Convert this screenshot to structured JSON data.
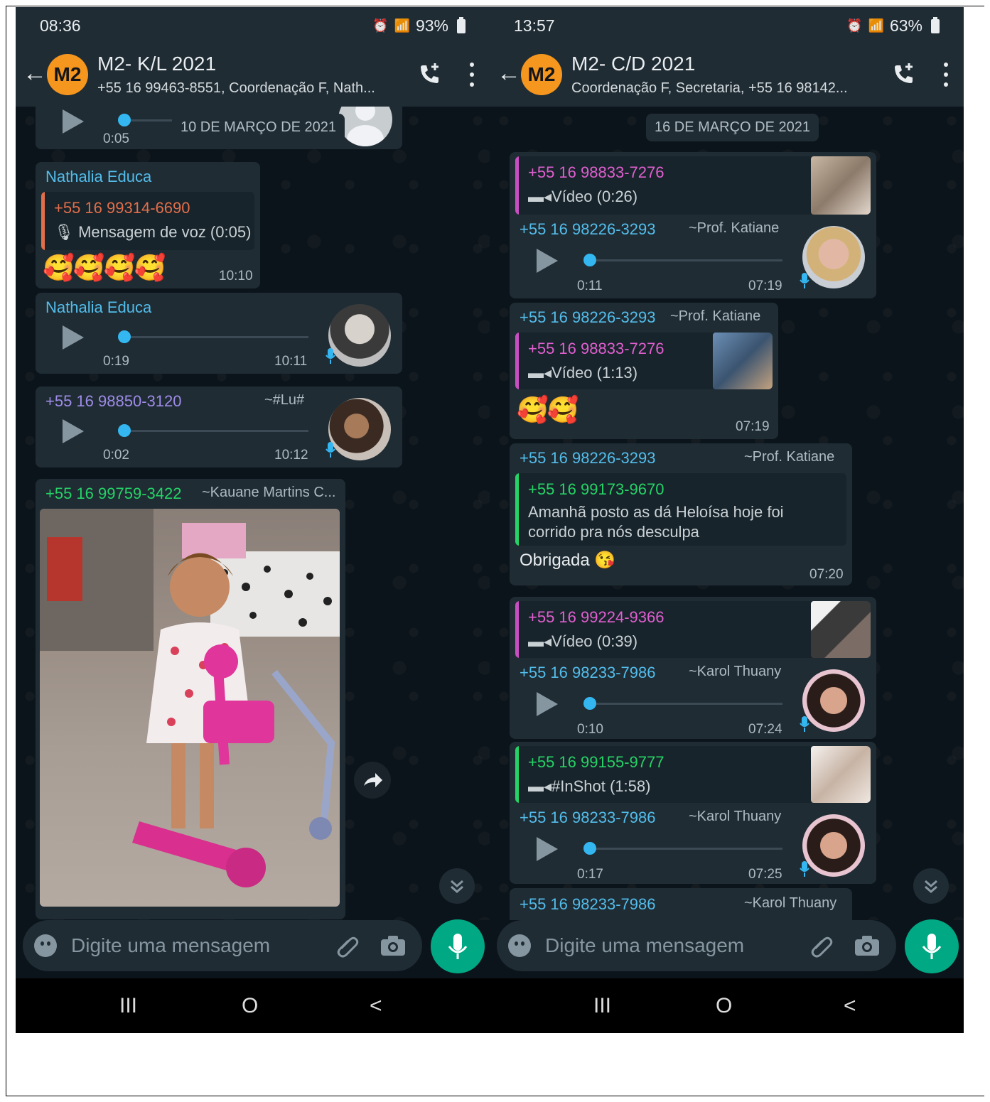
{
  "colors": {
    "green_accent": "#00a884",
    "bubble": "#1f2c34",
    "bg": "#0b141a",
    "group_avatar": "#f5961e"
  },
  "left": {
    "status": {
      "time": "08:36",
      "battery": "93%"
    },
    "header": {
      "avatar": "M2",
      "title": "M2- K/L 2021",
      "subtitle": "+55 16 99463-8551, Coordenação F, Nath..."
    },
    "date_pill": "10 DE MARÇO DE 2021",
    "msg0": {
      "duration": "0:05"
    },
    "msg1": {
      "sender": "Nathalia Educa",
      "quote_name": "+55 16 99314-6690",
      "quote_text": "Mensagem de voz (0:05)",
      "emoji": "🥰🥰🥰🥰",
      "time": "10:10"
    },
    "msg2": {
      "sender": "Nathalia Educa",
      "duration": "0:19",
      "time": "10:11"
    },
    "msg3": {
      "sender": "+55 16 98850-3120",
      "alias": "~#Lu#",
      "duration": "0:02",
      "time": "10:12"
    },
    "msg4": {
      "sender": "+55 16 99759-3422",
      "alias": "~Kauane Martins C..."
    },
    "composer": {
      "placeholder": "Digite uma mensagem"
    }
  },
  "right": {
    "status": {
      "time": "13:57",
      "battery": "63%"
    },
    "header": {
      "avatar": "M2",
      "title": "M2- C/D 2021",
      "subtitle": "Coordenação F, Secretaria, +55 16 98142..."
    },
    "date_pill": "16 DE MARÇO DE 2021",
    "msg1": {
      "quote_name": "+55 16 98833-7276",
      "quote_text": "Vídeo (0:26)",
      "sender": "+55 16 98226-3293",
      "alias": "~Prof. Katiane",
      "duration": "0:11",
      "time": "07:19"
    },
    "msg2": {
      "sender": "+55 16 98226-3293",
      "alias": "~Prof. Katiane",
      "quote_name": "+55 16 98833-7276",
      "quote_text": "Vídeo (1:13)",
      "emoji": "🥰🥰",
      "time": "07:19"
    },
    "msg3": {
      "sender": "+55 16 98226-3293",
      "alias": "~Prof. Katiane",
      "quote_name": "+55 16 99173-9670",
      "quote_line1": "Amanhã posto as dá Heloísa  hoje foi",
      "quote_line2": "corrido pra nós desculpa",
      "text": "Obrigada 😘",
      "time": "07:20"
    },
    "msg4": {
      "quote_name": "+55 16 99224-9366",
      "quote_text": "Vídeo (0:39)",
      "sender": "+55 16 98233-7986",
      "alias": "~Karol Thuany",
      "duration": "0:10",
      "time": "07:24"
    },
    "msg5": {
      "quote_name": "+55 16 99155-9777",
      "quote_text": "#InShot (1:58)",
      "sender": "+55 16 98233-7986",
      "alias": "~Karol Thuany",
      "duration": "0:17",
      "time": "07:25"
    },
    "msg6": {
      "sender": "+55 16 98233-7986",
      "alias": "~Karol Thuany"
    },
    "composer": {
      "placeholder": "Digite uma mensagem"
    }
  },
  "navbar": {
    "recents": "III",
    "home": "O",
    "back": "<"
  }
}
